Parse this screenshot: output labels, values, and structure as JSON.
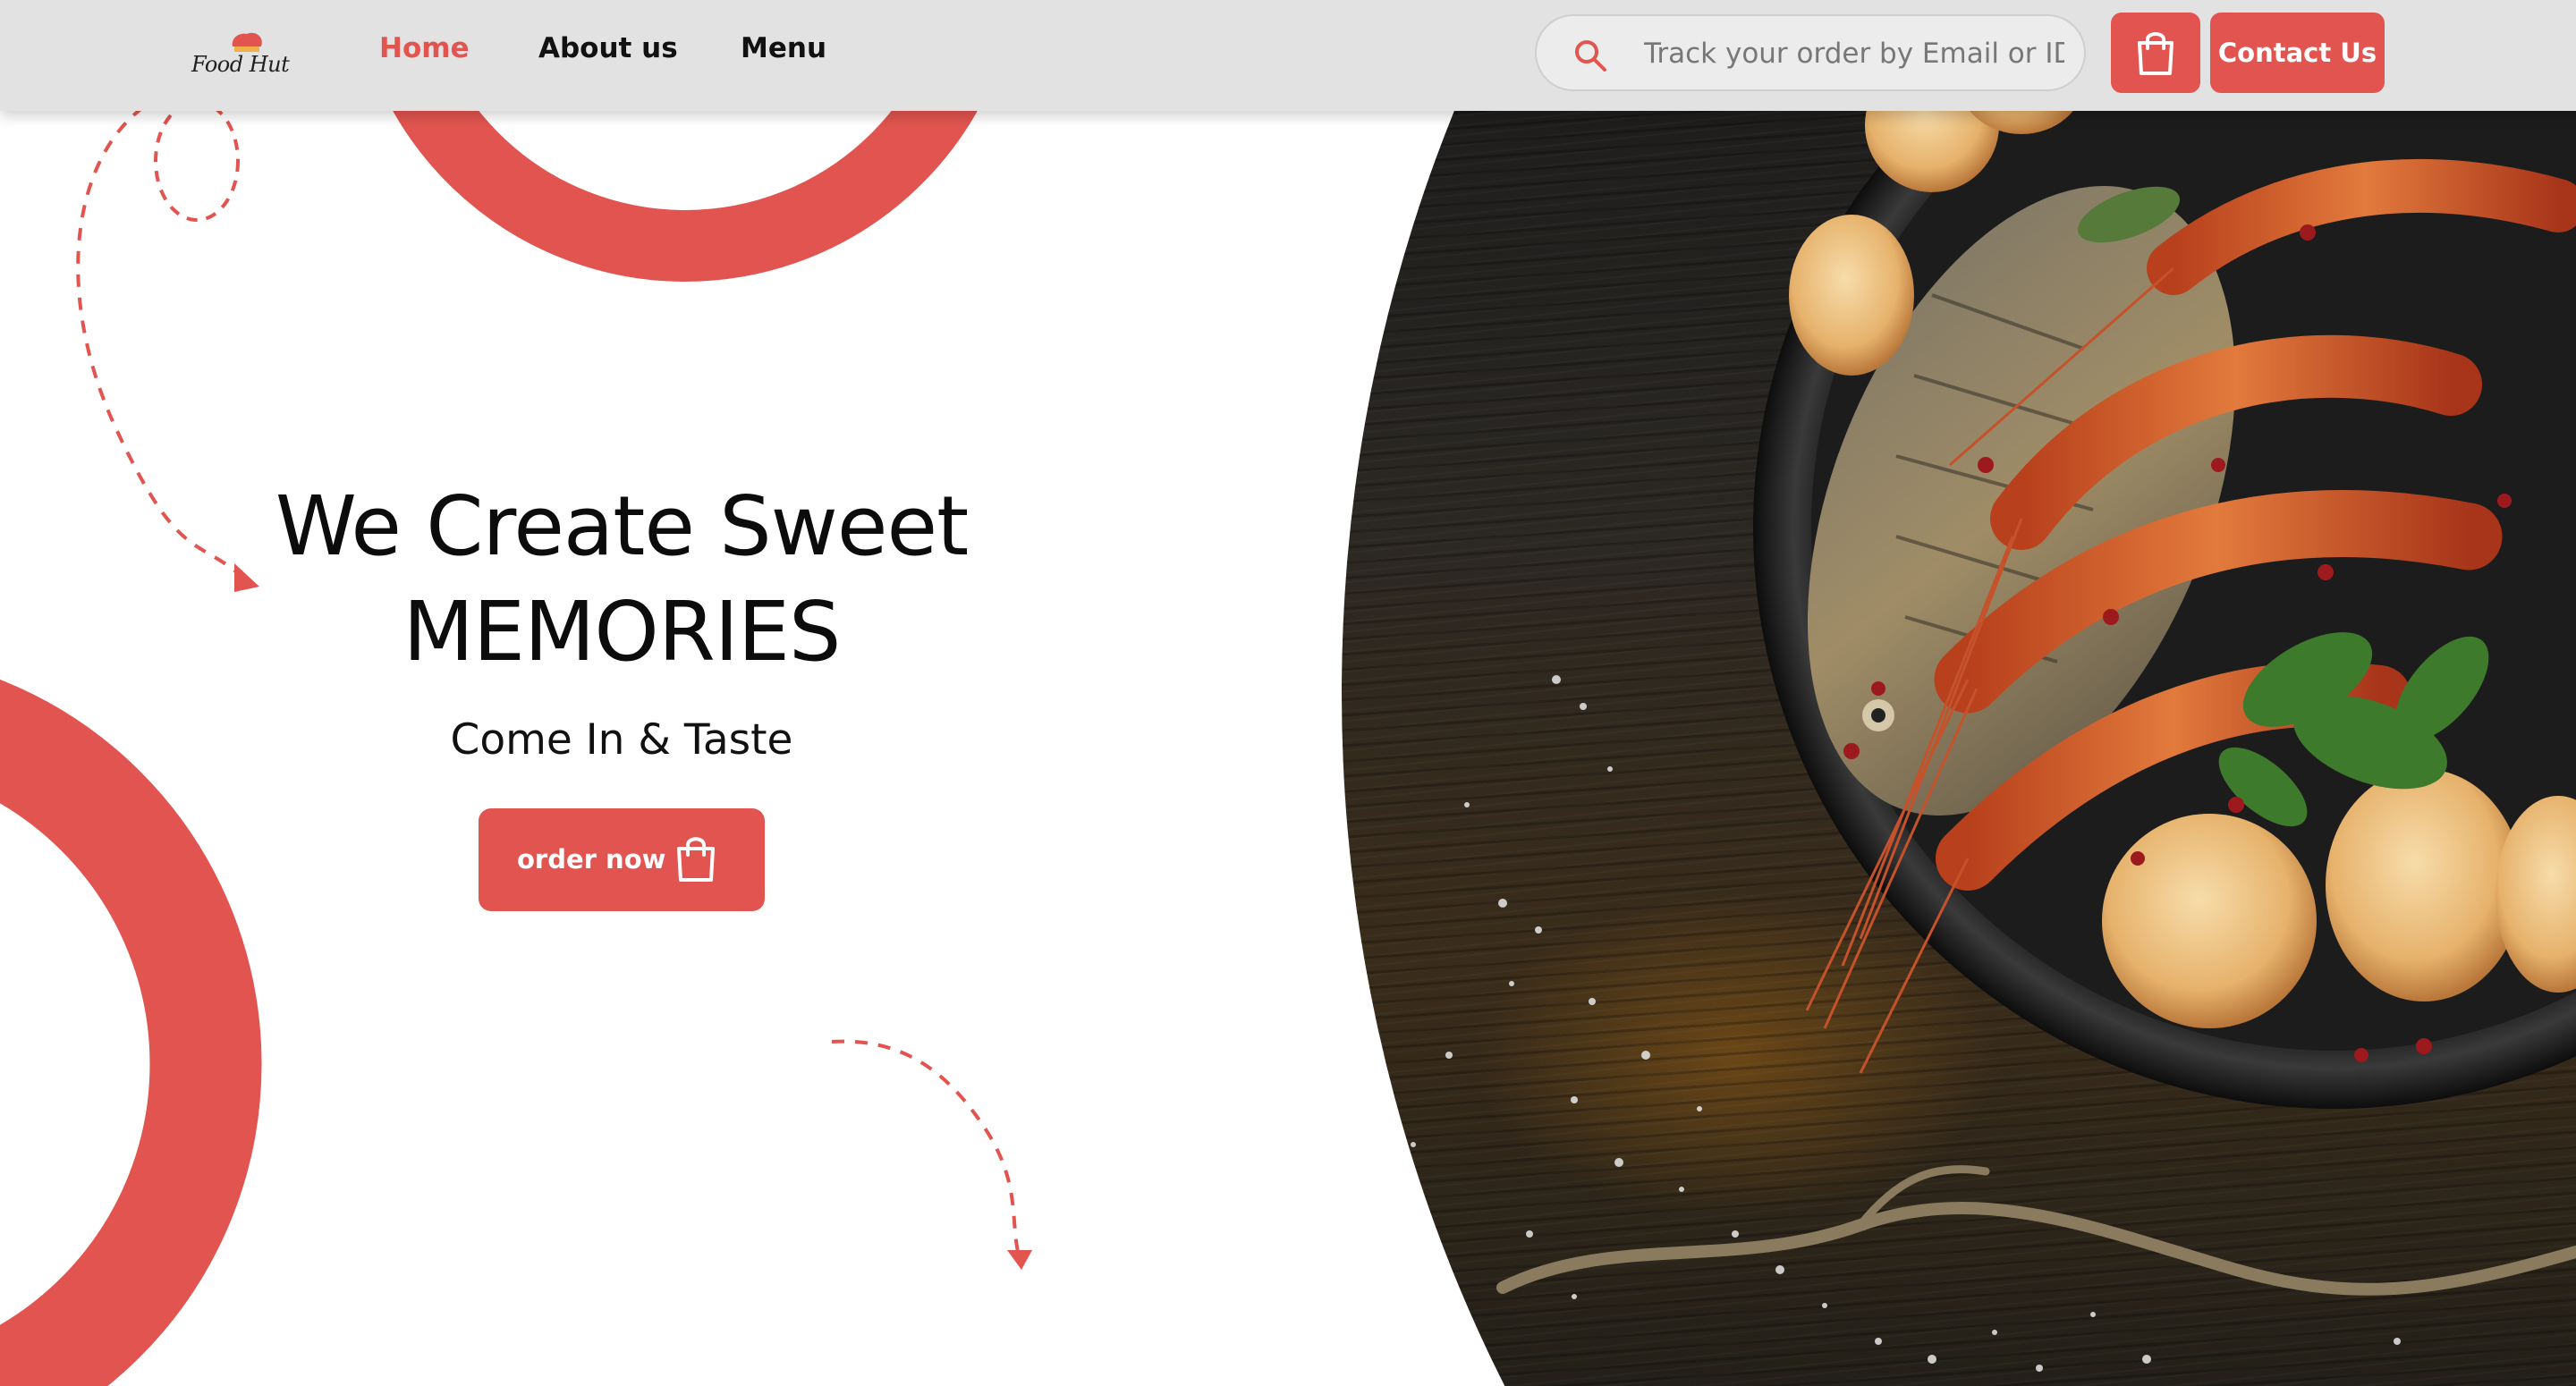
{
  "brand": {
    "logo_text": "Food Hut"
  },
  "nav": {
    "links": [
      {
        "label": "Home",
        "active": true
      },
      {
        "label": "About us",
        "active": false
      },
      {
        "label": "Menu",
        "active": false
      }
    ]
  },
  "search": {
    "placeholder": "Track your order by Email or ID",
    "value": ""
  },
  "actions": {
    "contact_label": "Contact Us"
  },
  "hero": {
    "title_line1": "We Create Sweet",
    "title_line2": "MEMORIES",
    "subtitle": "Come In & Taste",
    "order_label": "order now"
  },
  "icons": {
    "search": "search-icon",
    "cart": "shopping-bag-icon",
    "order": "shopping-bag-icon"
  },
  "colors": {
    "accent": "#e2544f",
    "navbar": "#e2e2e2",
    "text": "#111111"
  }
}
